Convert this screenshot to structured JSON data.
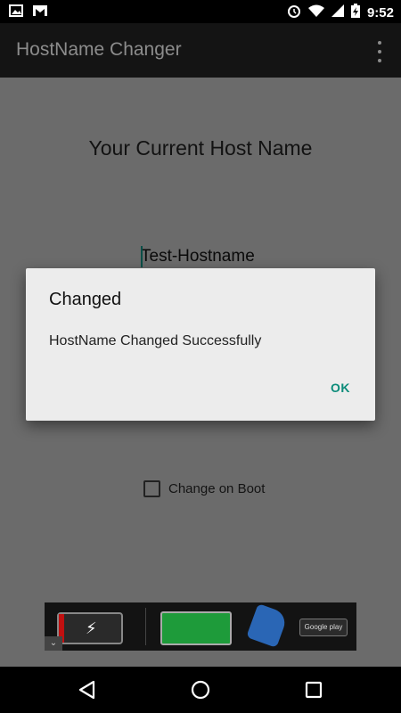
{
  "status_bar": {
    "time": "9:52",
    "icons": [
      "image-icon",
      "gmail-icon",
      "alarm-icon",
      "wifi-icon",
      "signal-icon",
      "battery-charging-icon"
    ]
  },
  "app_bar": {
    "title": "HostName Changer",
    "overflow_icon": "more-vert-icon"
  },
  "main": {
    "heading": "Your Current Host Name",
    "hostname_value": "Test-Hostname",
    "change_on_boot_label": "Change on Boot",
    "change_on_boot_checked": false
  },
  "dialog": {
    "title": "Changed",
    "message": "HostName Changed Successfully",
    "ok_label": "OK"
  },
  "ad_banner": {
    "badge": "Google play"
  },
  "nav_bar": {
    "buttons": [
      "back-icon",
      "home-icon",
      "recents-icon"
    ]
  },
  "colors": {
    "accent": "#0c8c7a",
    "input_underline": "#8b1f1f",
    "scrim_background": "#6b6b6b",
    "dialog_background": "#ececec"
  }
}
